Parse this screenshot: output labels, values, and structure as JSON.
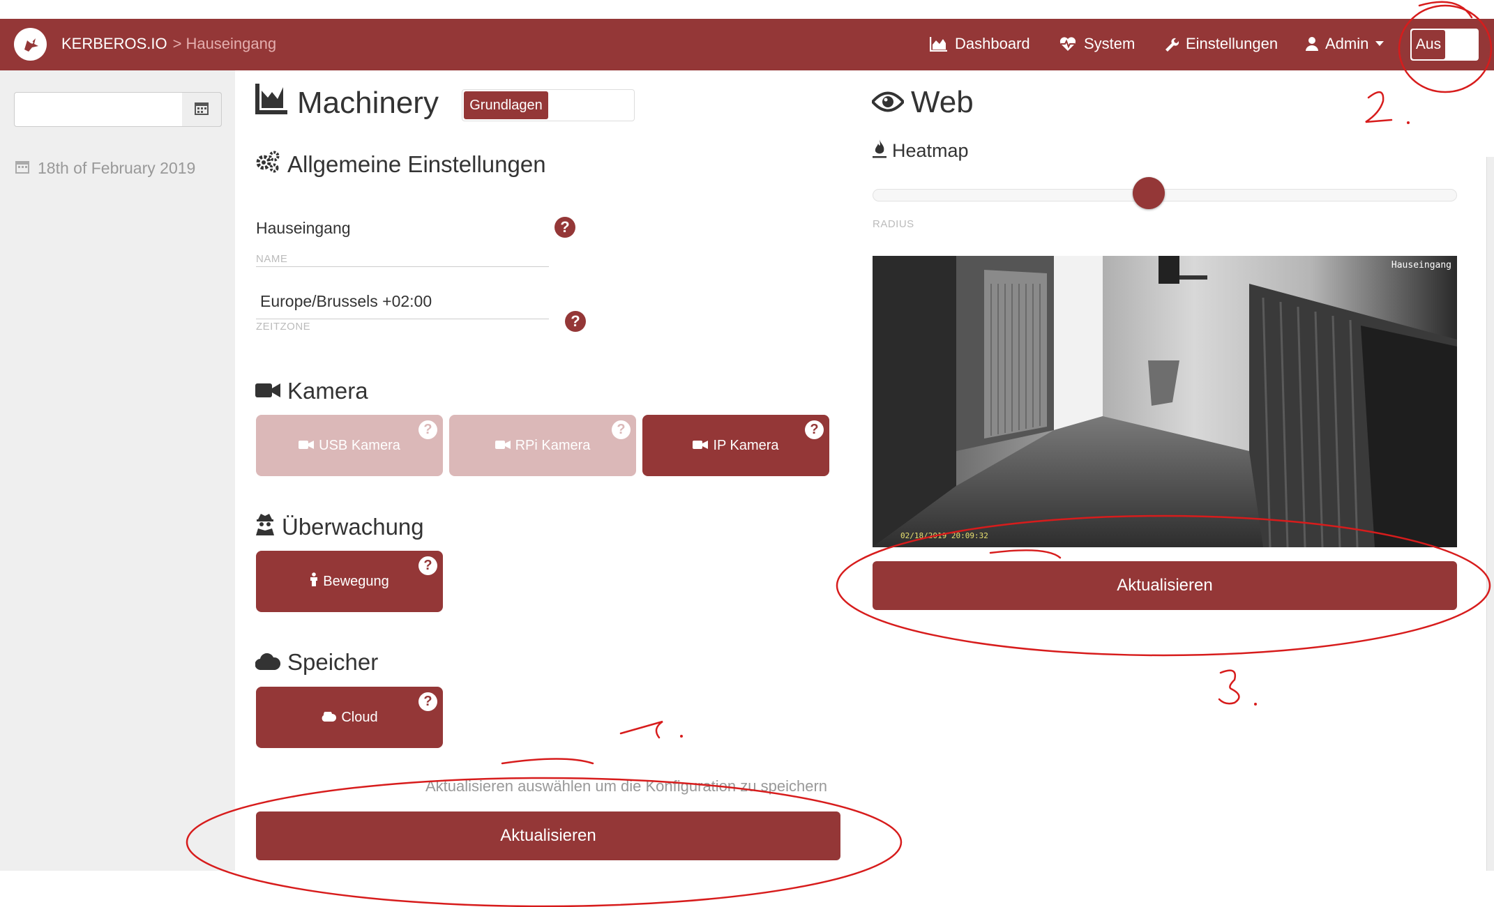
{
  "nav": {
    "brand": "KERBEROS.IO",
    "separator": ">",
    "breadcrumb": "Hauseingang",
    "items": [
      {
        "label": "Dashboard",
        "icon": "area-chart-icon"
      },
      {
        "label": "System",
        "icon": "heartbeat-icon"
      },
      {
        "label": "Einstellungen",
        "icon": "wrench-icon"
      },
      {
        "label": "Admin",
        "icon": "user-icon"
      }
    ],
    "toggle_label": "Aus"
  },
  "sidebar": {
    "date_input_value": "",
    "date": "18th of February 2019"
  },
  "machinery": {
    "title": "Machinery",
    "mode_active": "Grundlagen",
    "general": {
      "title": "Allgemeine Einstellungen",
      "name_value": "Hauseingang",
      "name_label": "NAME",
      "timezone_value": "Europe/Brussels +02:00",
      "timezone_label": "ZEITZONE"
    },
    "camera": {
      "title": "Kamera",
      "options": [
        {
          "label": "USB Kamera",
          "state": "inactive"
        },
        {
          "label": "RPi Kamera",
          "state": "inactive"
        },
        {
          "label": "IP Kamera",
          "state": "active"
        }
      ]
    },
    "surveillance": {
      "title": "Überwachung",
      "option": "Bewegung"
    },
    "storage": {
      "title": "Speicher",
      "option": "Cloud"
    },
    "hint": "Aktualisieren auswählen um die Konfiguration zu speichern",
    "update_button": "Aktualisieren"
  },
  "web": {
    "title": "Web",
    "heatmap": {
      "title": "Heatmap",
      "slider_label": "RADIUS",
      "slider_fraction": 0.48
    },
    "camera_overlay": "Hauseingang",
    "camera_timestamp": "02/18/2019  20:09:32",
    "update_button": "Aktualisieren"
  },
  "annotations": [
    "1.",
    "2.",
    "3."
  ],
  "colors": {
    "primary": "#943737",
    "disabled": "#dbb8b8",
    "annotation": "#d71c1c"
  }
}
